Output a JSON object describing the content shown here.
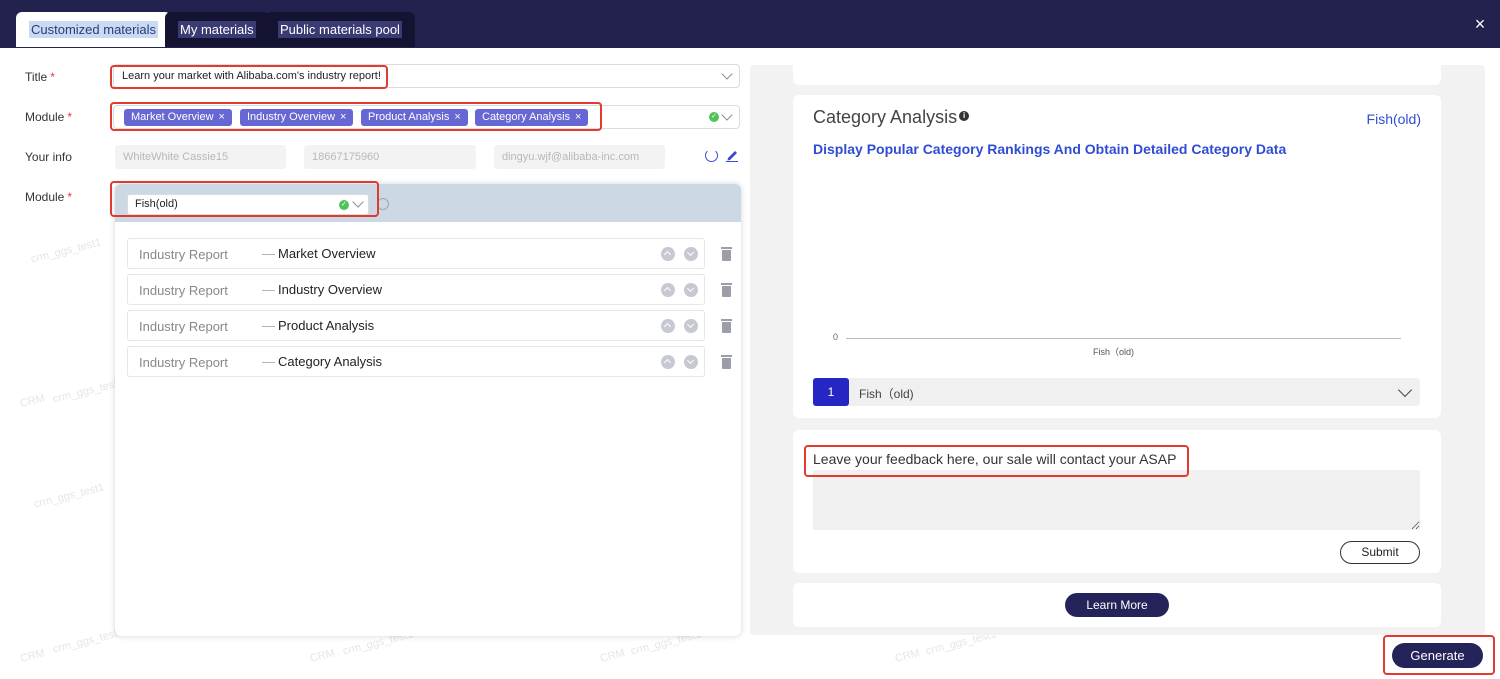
{
  "tabs": [
    {
      "label": "Customized materials",
      "active": true
    },
    {
      "label": "My materials",
      "active": false
    },
    {
      "label": "Public materials pool",
      "active": false
    }
  ],
  "close_icon": "×",
  "form": {
    "title_label": "Title",
    "title_value": "Learn your market with Alibaba.com's industry report!",
    "module_label": "Module",
    "required_mark": "*",
    "module_tags": [
      "Market Overview",
      "Industry Overview",
      "Product Analysis",
      "Category Analysis"
    ],
    "tag_remove": "×",
    "info_label": "Your info",
    "info_name": "WhiteWhite Cassie15",
    "info_phone": "18667175960",
    "info_email": "dingyu.wjf@alibaba-inc.com",
    "module2_label": "Module",
    "module2_value": "Fish(old)"
  },
  "reports": [
    {
      "type": "Industry Report",
      "dash": "—",
      "name": "Market Overview"
    },
    {
      "type": "Industry Report",
      "dash": "—",
      "name": "Industry Overview"
    },
    {
      "type": "Industry Report",
      "dash": "—",
      "name": "Product Analysis"
    },
    {
      "type": "Industry Report",
      "dash": "—",
      "name": "Category Analysis"
    }
  ],
  "preview": {
    "category_title": "Category Analysis",
    "info_icon": "i",
    "category_right": "Fish(old)",
    "category_sub": "Display Popular Category Rankings And Obtain Detailed Category Data",
    "axis_zero": "0",
    "axis_category": "Fish（old)",
    "rank_number": "1",
    "rank_name": "Fish（old)",
    "feedback_label": "Leave your feedback here, our sale will contact your ASAP",
    "submit_label": "Submit",
    "learn_more_label": "Learn More"
  },
  "generate_label": "Generate",
  "watermark": {
    "crm": "CRM",
    "user": "crm_ggs_test1"
  },
  "colors": {
    "header": "#23224f",
    "accent": "#2f4dd4",
    "tag": "#6767d4",
    "button": "#24245a",
    "highlight": "#e03b30"
  },
  "icons": [
    "close-icon",
    "chevron-down-icon",
    "check-circle-icon",
    "refresh-icon",
    "edit-icon",
    "arrow-up-icon",
    "arrow-down-icon",
    "trash-icon",
    "info-icon"
  ]
}
